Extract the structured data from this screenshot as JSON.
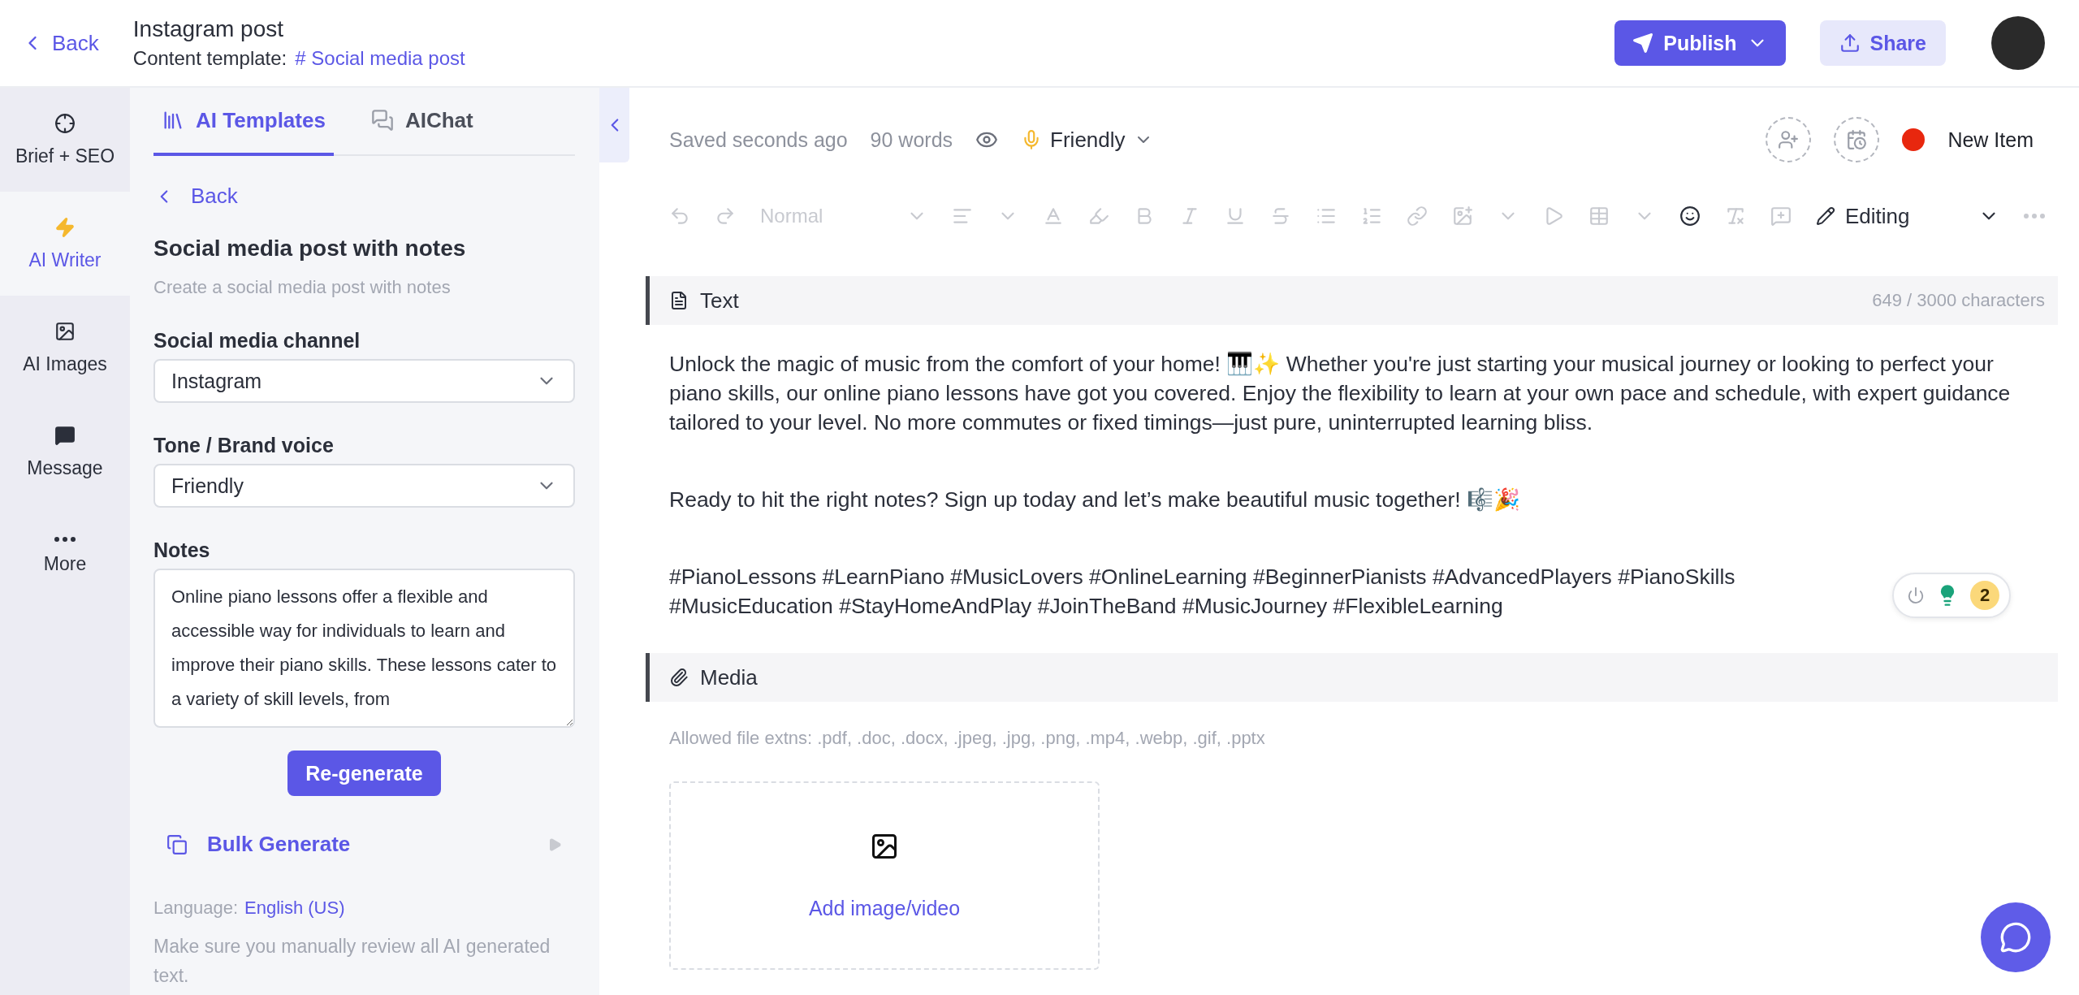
{
  "header": {
    "back": "Back",
    "title": "Instagram post",
    "template_label": "Content template:",
    "template_hash": "#",
    "template_link": "Social media post",
    "publish": "Publish",
    "share": "Share"
  },
  "rail": [
    {
      "label": "Brief + SEO",
      "selected": false
    },
    {
      "label": "AI Writer",
      "selected": true
    },
    {
      "label": "AI Images",
      "selected": false
    },
    {
      "label": "Message",
      "selected": false
    },
    {
      "label": "More",
      "selected": false
    }
  ],
  "panel": {
    "tabs": [
      {
        "label": "AI Templates",
        "selected": true
      },
      {
        "label": "AIChat",
        "selected": false
      }
    ],
    "back": "Back",
    "title": "Social media post with notes",
    "subtitle": "Create a social media post with notes",
    "fields": [
      {
        "label": "Social media channel",
        "value": "Instagram"
      },
      {
        "label": "Tone / Brand voice",
        "value": "Friendly"
      }
    ],
    "notes": {
      "label": "Notes",
      "value": "Online piano lessons offer a flexible and accessible way for individuals to learn and improve their piano skills. These lessons cater to a variety of skill levels, from"
    },
    "regenerate": "Re-generate",
    "bulk": "Bulk Generate",
    "language_label": "Language:",
    "language": "English (US)",
    "disclaimer": "Make sure you manually review all AI generated text."
  },
  "editor": {
    "saved": "Saved seconds ago",
    "words": "90 words",
    "tone": "Friendly",
    "new_item": {
      "label": "New Item",
      "color": "#e8270e"
    },
    "toolbar": {
      "style": "Normal",
      "mode": "Editing"
    },
    "text_section": {
      "title": "Text",
      "count": "649 / 3000 characters",
      "paragraphs": [
        "Unlock the magic of music from the comfort of your home! 🎹✨ Whether you're just starting your musical journey or looking to perfect your piano skills, our online piano lessons have got you covered. Enjoy the flexibility to learn at your own pace and schedule, with expert guidance tailored to your level. No more commutes or fixed timings—just pure, uninterrupted learning bliss.",
        "Ready to hit the right notes? Sign up today and let’s make beautiful music together! 🎼🎉",
        "#PianoLessons #LearnPiano #MusicLovers #OnlineLearning #BeginnerPianists #AdvancedPlayers #PianoSkills #MusicEducation #StayHomeAndPlay #JoinTheBand #MusicJourney #FlexibleLearning"
      ]
    },
    "widget_count": "2",
    "media_section": {
      "title": "Media",
      "hint": "Allowed file extns: .pdf, .doc, .docx, .jpeg, .jpg, .png, .mp4, .webp, .gif, .pptx",
      "upload": "Add image/video"
    }
  }
}
